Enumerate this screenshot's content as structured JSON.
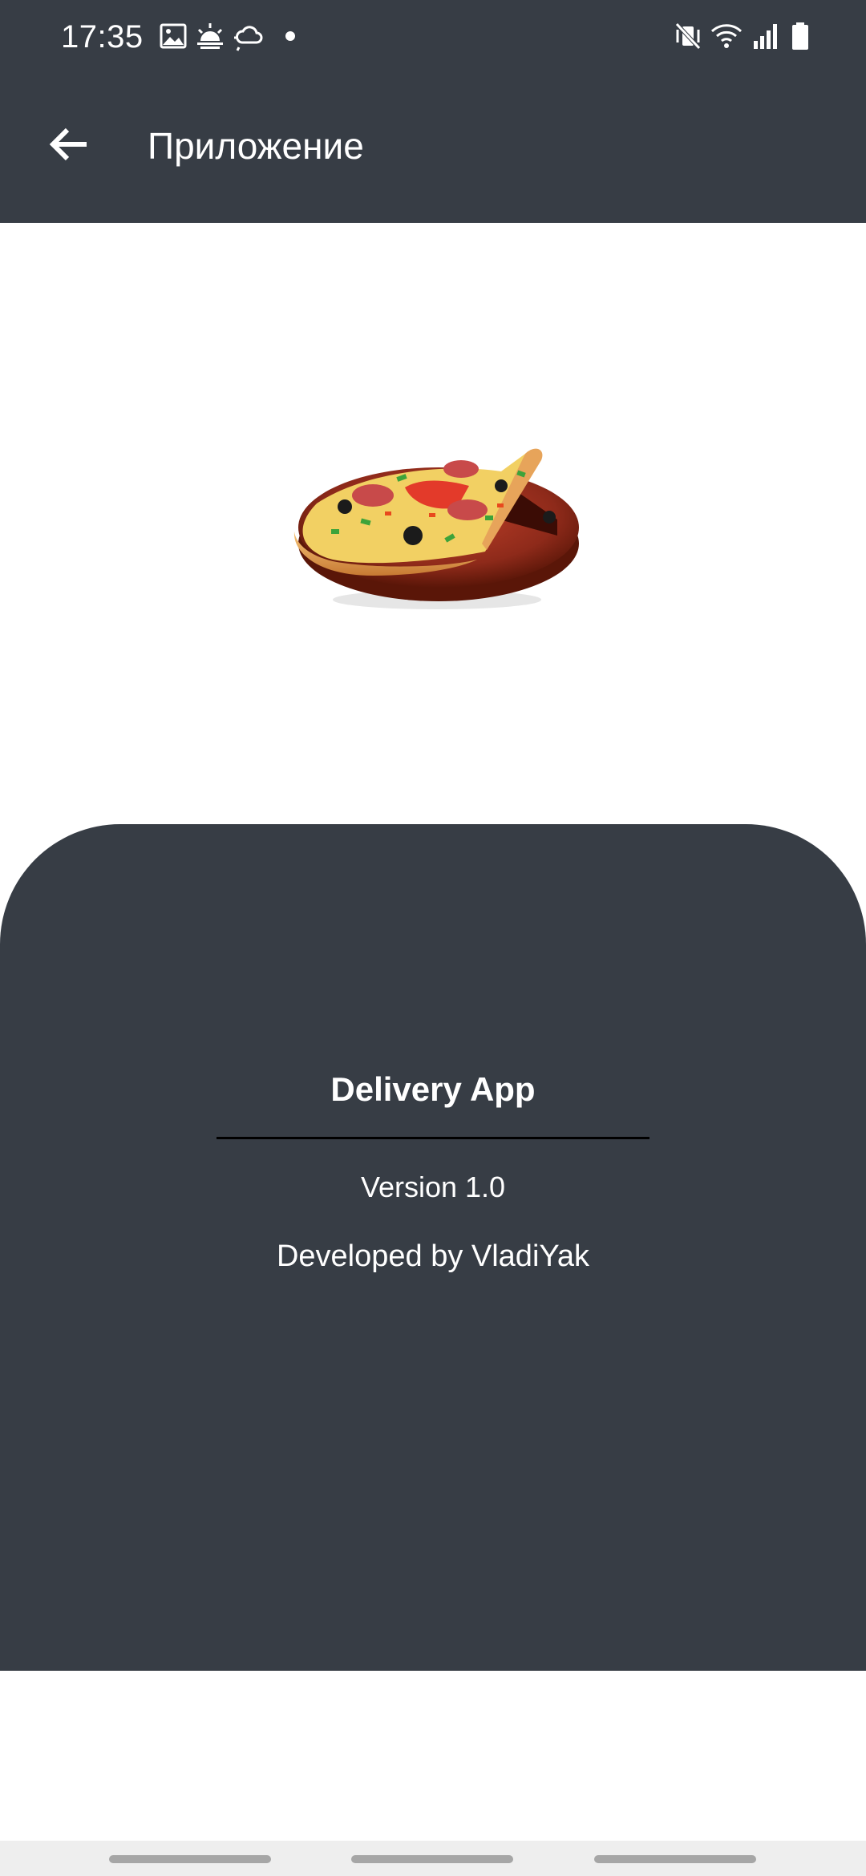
{
  "status_bar": {
    "time": "17:35",
    "left_icons": [
      "gallery-icon",
      "sunrise-icon",
      "weather-icon",
      "notification-dot-icon"
    ],
    "right_icons": [
      "vibrate-mute-icon",
      "wifi-icon",
      "signal-icon",
      "battery-icon"
    ]
  },
  "app_bar": {
    "back_icon": "arrow-left-icon",
    "title": "Приложение"
  },
  "hero": {
    "image": "pizza-illustration"
  },
  "info": {
    "app_name": "Delivery App",
    "version": "Version 1.0",
    "developer": "Developed by VladiYak"
  },
  "colors": {
    "primary_dark": "#373d45",
    "background": "#ffffff",
    "text_on_dark": "#ffffff",
    "divider": "#000000",
    "nav_bar": "#eeeeee"
  }
}
